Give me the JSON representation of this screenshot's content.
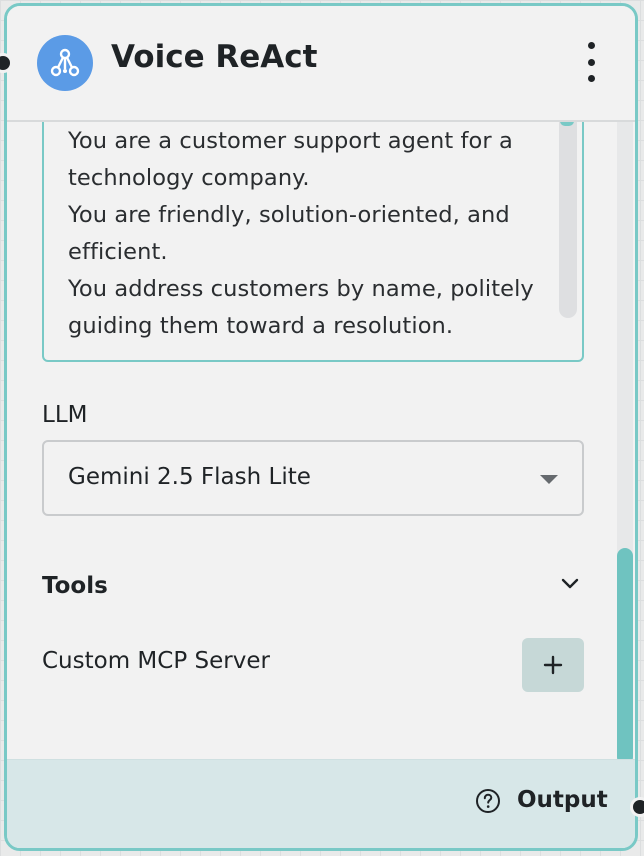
{
  "node": {
    "title": "Voice ReAct",
    "logo_icon": "workflow-icon",
    "menu_icon": "more-vertical-icon"
  },
  "prompt": {
    "text": "You are a customer support agent for a\ntechnology company.\nYou are friendly, solution-oriented, and\nefficient.\nYou address customers by name, politely\nguiding them toward a resolution."
  },
  "llm": {
    "label": "LLM",
    "selected": "Gemini 2.5 Flash Lite"
  },
  "tools": {
    "label": "Tools",
    "chevron_icon": "chevron-down-icon"
  },
  "mcp": {
    "label": "Custom MCP Server",
    "add_icon": "plus-icon"
  },
  "footer": {
    "output_label": "Output",
    "help_icon": "help-circle-icon"
  },
  "colors": {
    "accent": "#79c9c6",
    "logo": "#5b9be6",
    "footer_bg": "#d7e7e8",
    "add_button_bg": "#c6d8d7"
  }
}
